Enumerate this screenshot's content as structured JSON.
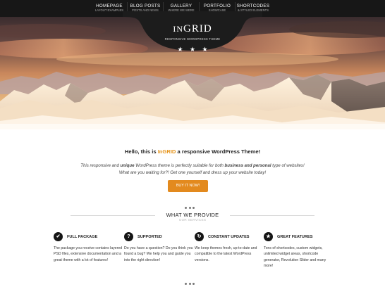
{
  "nav": {
    "items": [
      {
        "label": "HOMEPAGE",
        "sub": "LAYOUT EXAMPLES"
      },
      {
        "label": "BLOG POSTS",
        "sub": "POSTS AND NEWS"
      },
      {
        "label": "GALLERY",
        "sub": "WHERE WE WERE"
      },
      {
        "label": "PORTFOLIO",
        "sub": "SHOWCASE"
      },
      {
        "label": "SHORTCODES",
        "sub": "& STYLED ELEMENTS"
      }
    ]
  },
  "logo": {
    "prefix": "IN",
    "name": "GRID",
    "tagline": "RESPONSIVE WORDPRESS THEME"
  },
  "hello": {
    "before": "Hello, this is ",
    "brand": "InGRID",
    "after": " a responsive WordPress Theme!"
  },
  "intro": {
    "line1_a": "This responsive and ",
    "line1_b": "unique",
    "line1_c": " WordPress theme is perfectly suitable for both ",
    "line1_d": "business and personal",
    "line1_e": " type of websites!",
    "line2": "What are you waiting for?! Get one yourself and dress up your website today!"
  },
  "buy_button": "BUY IT NOW!",
  "section": {
    "title": "WHAT WE PROVIDE",
    "subtitle": "OUR SERVICES"
  },
  "features": [
    {
      "icon": "check-icon",
      "glyph": "✔",
      "title": "FULL PACKAGE",
      "desc": "The package you receive contains layered PSD files, extensive documentation and a great theme with a lot of features!"
    },
    {
      "icon": "question-icon",
      "glyph": "?",
      "title": "SUPPORTED",
      "desc": "Do you have a question? Do you think you found a bug? We help you and guide you into the right direction!"
    },
    {
      "icon": "refresh-icon",
      "glyph": "↻",
      "title": "CONSTANT UPDATES",
      "desc": "We keep themes fresh, up-to-date and compatible to the latest WordPress versions."
    },
    {
      "icon": "star-icon",
      "glyph": "★",
      "title": "GREAT FEATURES",
      "desc": "Tons of shortcodes, custom widgets, unlimited widget areas, shortcode generator, Revolution Slider and many more!"
    }
  ],
  "colors": {
    "accent": "#e6951c",
    "button": "#e38a1e",
    "topbar": "#171717"
  }
}
